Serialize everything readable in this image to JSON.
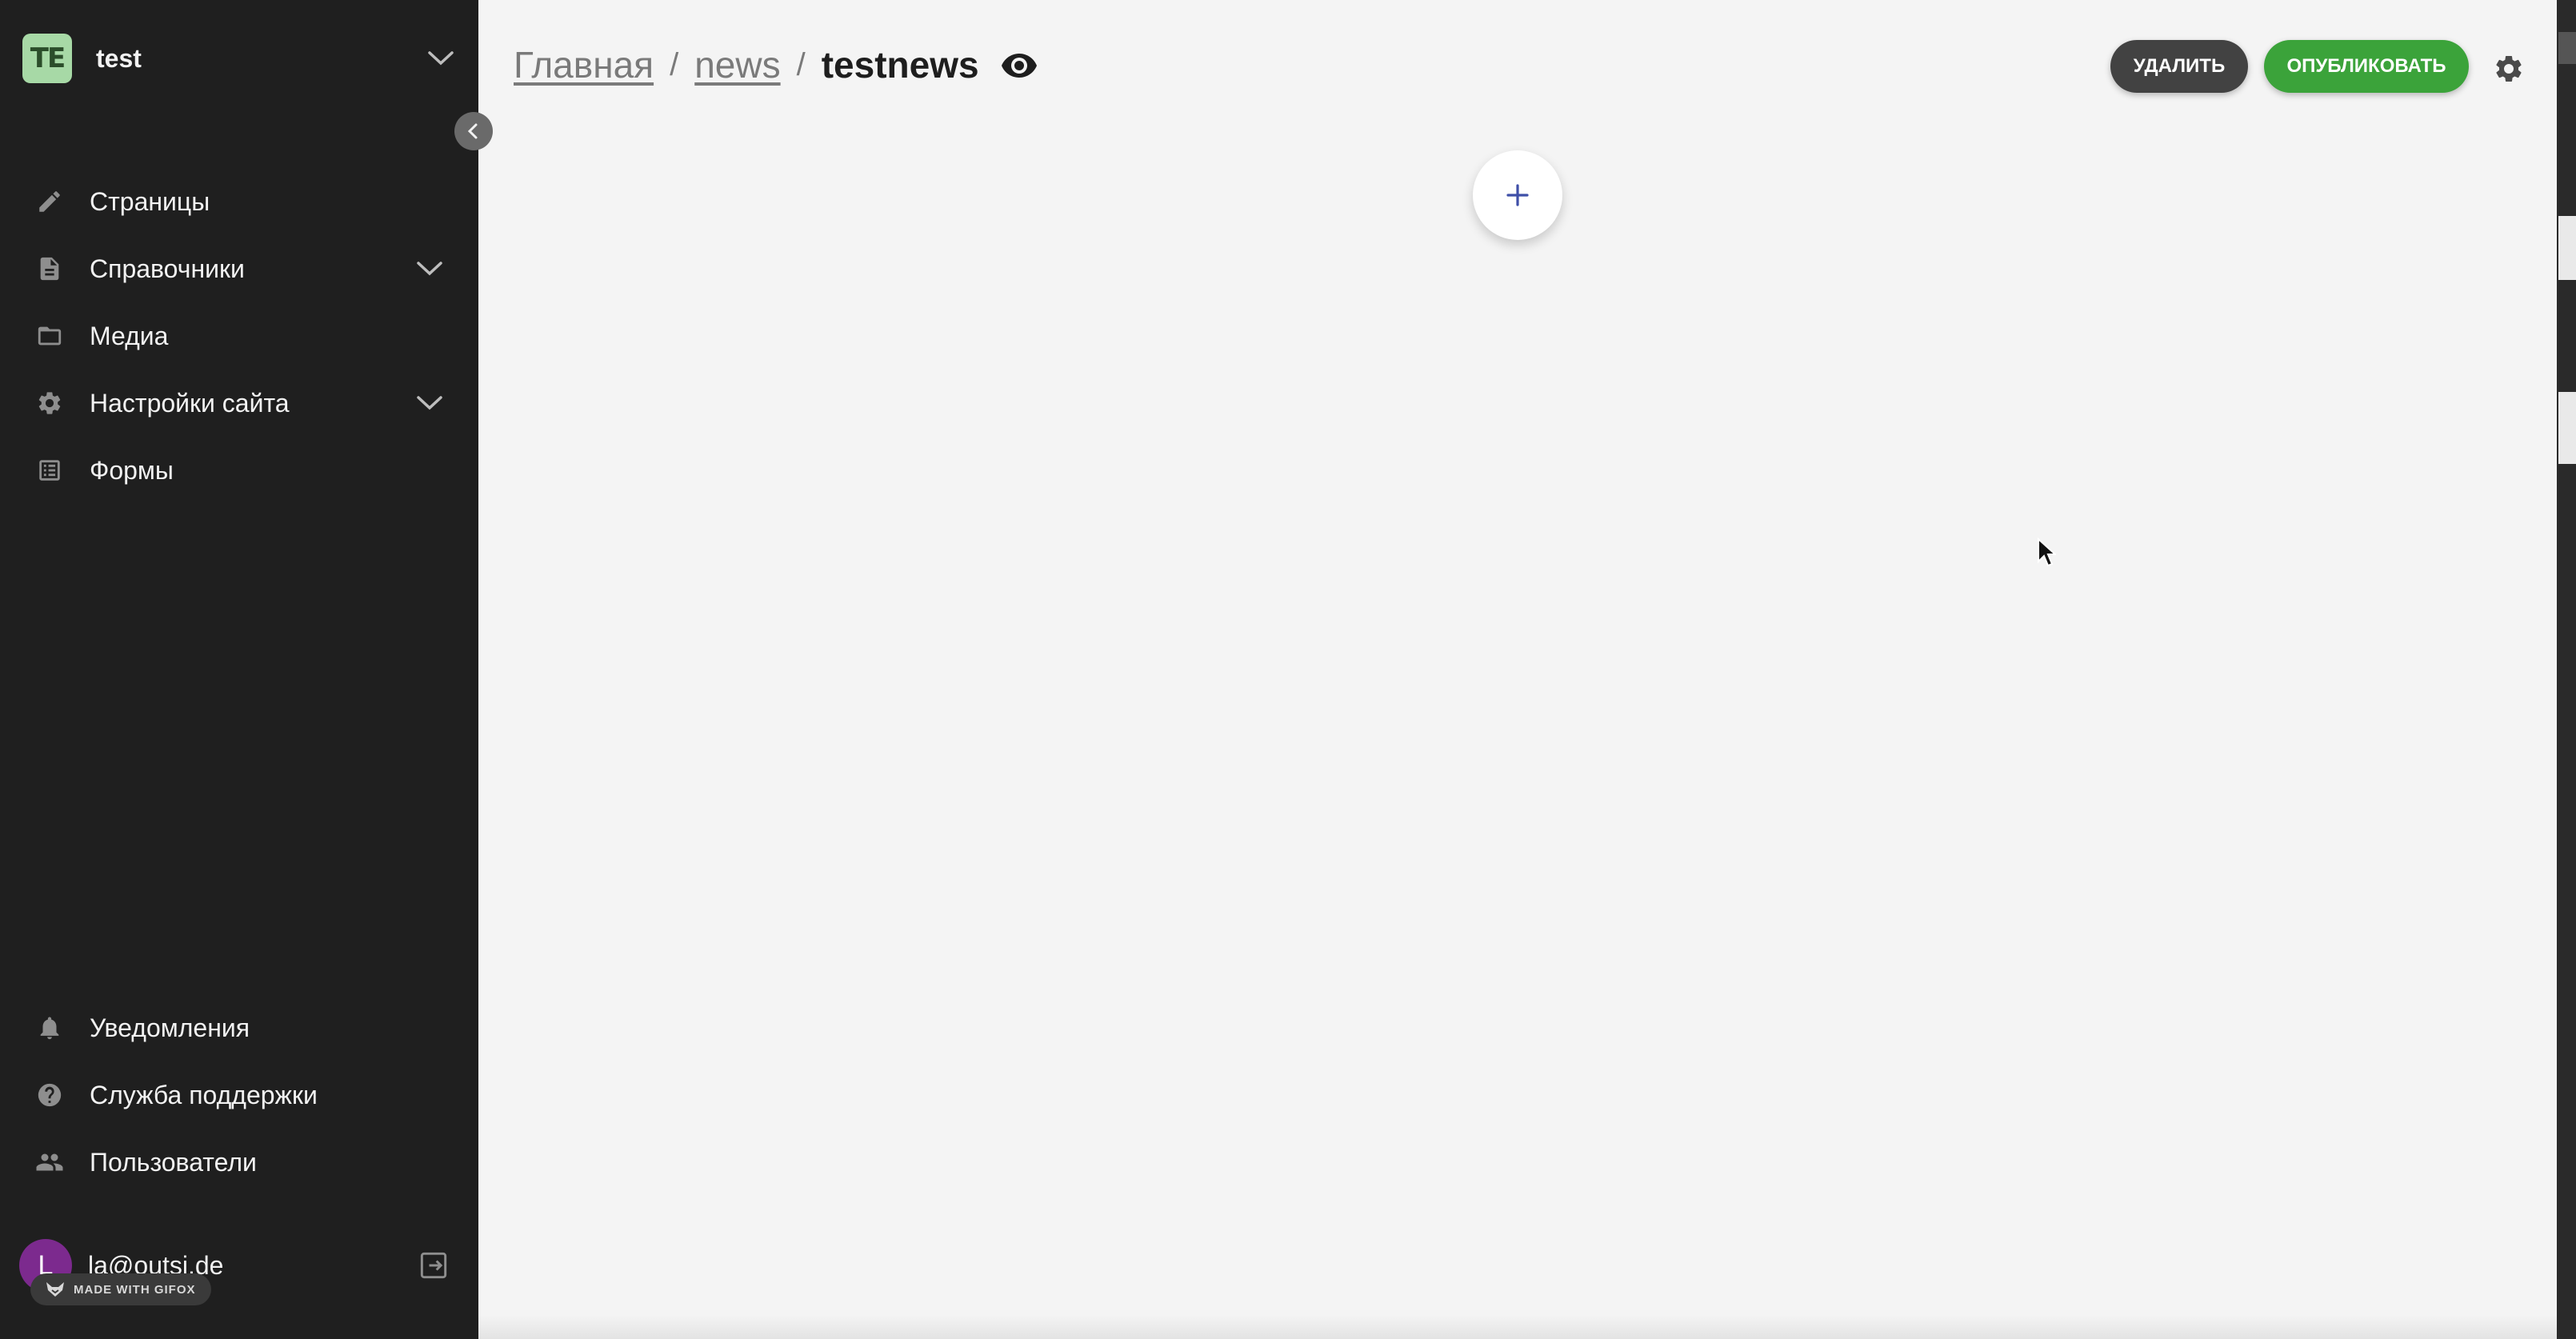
{
  "workspace": {
    "initials": "TE",
    "name": "test"
  },
  "sidebar": {
    "items": [
      {
        "label": "Страницы",
        "icon": "pencil-icon",
        "expandable": false
      },
      {
        "label": "Справочники",
        "icon": "document-icon",
        "expandable": true
      },
      {
        "label": "Медиа",
        "icon": "folder-icon",
        "expandable": false
      },
      {
        "label": "Настройки сайта",
        "icon": "gear-icon",
        "expandable": true
      },
      {
        "label": "Формы",
        "icon": "list-icon",
        "expandable": false
      }
    ],
    "bottom_items": [
      {
        "label": "Уведомления",
        "icon": "bell-icon"
      },
      {
        "label": "Служба поддержки",
        "icon": "help-icon"
      },
      {
        "label": "Пользователи",
        "icon": "users-icon"
      }
    ],
    "user": {
      "initial": "L",
      "email": "la@outsi.de"
    },
    "badge": "MADE WITH GIFOX"
  },
  "breadcrumb": {
    "home": "Главная",
    "section": "news",
    "current": "testnews",
    "separator": "/"
  },
  "actions": {
    "delete_label": "УДАЛИТЬ",
    "publish_label": "ОПУБЛИКОВАТЬ"
  },
  "add_block_label": "+",
  "colors": {
    "sidebar_bg": "#1f1f1f",
    "main_bg": "#f4f4f4",
    "publish": "#3ba33a",
    "delete": "#424242",
    "add_plus": "#3f4fa8",
    "workspace_avatar": "#a7d9a6",
    "user_avatar": "#7c2a8e"
  }
}
